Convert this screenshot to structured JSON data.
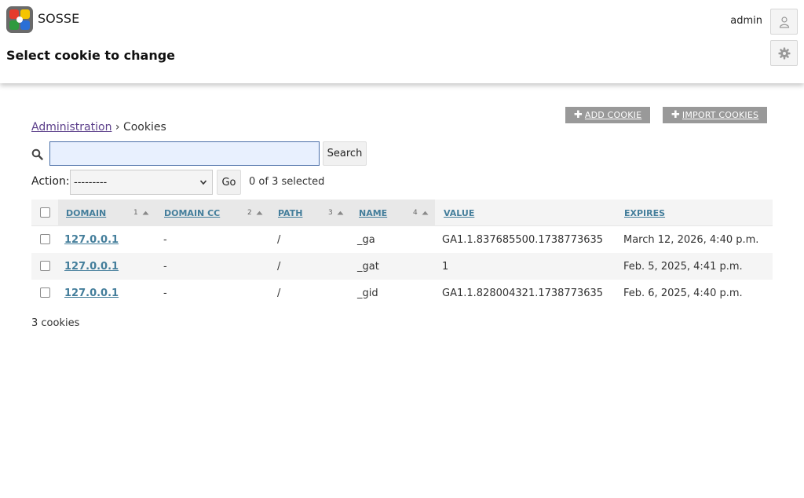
{
  "app": {
    "name": "SOSSE"
  },
  "page": {
    "title": "Select cookie to change"
  },
  "user": {
    "name": "admin"
  },
  "toolbar": {
    "add_label": "Add cookie",
    "import_label": "Import cookies"
  },
  "breadcrumb": {
    "root": "Administration",
    "separator": "›",
    "current": "Cookies"
  },
  "search": {
    "value": "",
    "button_label": "Search"
  },
  "actions": {
    "label": "Action:",
    "selected_option": "---------",
    "go_label": "Go",
    "selected_text": "0 of 3 selected"
  },
  "table": {
    "columns": [
      {
        "label": "Domain",
        "sort_priority": "1"
      },
      {
        "label": "Domain CC",
        "sort_priority": "2"
      },
      {
        "label": "Path",
        "sort_priority": "3"
      },
      {
        "label": "Name",
        "sort_priority": "4"
      },
      {
        "label": "Value",
        "sort_priority": ""
      },
      {
        "label": "Expires",
        "sort_priority": ""
      }
    ],
    "rows": [
      {
        "domain": "127.0.0.1",
        "domain_cc": "-",
        "path": "/",
        "name": "_ga",
        "value": "GA1.1.837685500.1738773635",
        "expires": "March 12, 2026, 4:40 p.m."
      },
      {
        "domain": "127.0.0.1",
        "domain_cc": "-",
        "path": "/",
        "name": "_gat",
        "value": "1",
        "expires": "Feb. 5, 2025, 4:41 p.m."
      },
      {
        "domain": "127.0.0.1",
        "domain_cc": "-",
        "path": "/",
        "name": "_gid",
        "value": "GA1.1.828004321.1738773635",
        "expires": "Feb. 6, 2025, 4:40 p.m."
      }
    ]
  },
  "footer": {
    "total": "3 cookies"
  },
  "colors": {
    "link": "#447e9b",
    "breadcrumb_link": "#5b3e8a",
    "tool_button": "#999999",
    "search_focus": "#e8f0fe"
  },
  "icons": {
    "logo": "sosse-logo",
    "user": "user-icon",
    "settings": "gear-icon",
    "search": "search-icon",
    "add": "plus-icon",
    "sort": "sort-ascending-icon"
  }
}
